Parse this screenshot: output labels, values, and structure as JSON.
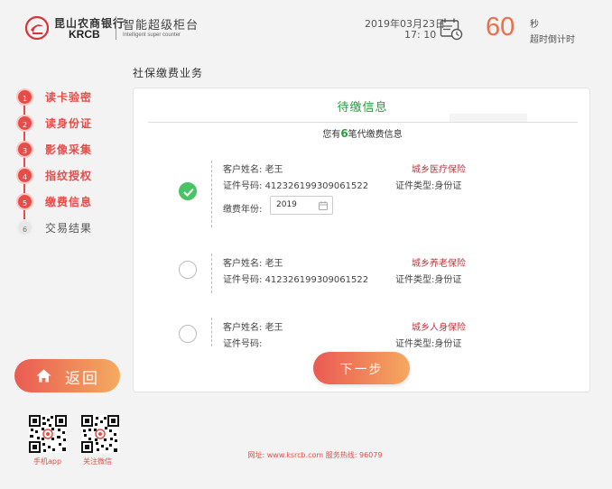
{
  "header": {
    "bank_name_cn": "昆山农商银行",
    "bank_name_en": "KRCB",
    "system_name": "智能超级柜台",
    "system_name_en": "Intelligent super counter",
    "date": "2019年03月23日",
    "time": "17: 10",
    "countdown_value": "60",
    "countdown_unit": "秒",
    "countdown_label": "超时倒计时"
  },
  "page_title": "社保缴费业务",
  "steps": [
    {
      "num": "1",
      "label": "读卡验密",
      "status": "done"
    },
    {
      "num": "2",
      "label": "读身份证",
      "status": "done"
    },
    {
      "num": "3",
      "label": "影像采集",
      "status": "done"
    },
    {
      "num": "4",
      "label": "指纹授权",
      "status": "done"
    },
    {
      "num": "5",
      "label": "缴费信息",
      "status": "active"
    },
    {
      "num": "6",
      "label": "交易结果",
      "status": "pending"
    }
  ],
  "back_button": {
    "label": "返回"
  },
  "panel": {
    "title": "待缴信息",
    "summary_prefix": "您有",
    "summary_count": "6",
    "summary_suffix": "笔代缴费信息",
    "items": [
      {
        "name_label": "客户姓名:",
        "name": "老王",
        "id_label": "证件号码:",
        "id_number": "412326199309061522",
        "insurance": "城乡医疗保险",
        "id_type_label": "证件类型:",
        "id_type": "身份证",
        "year_label": "缴费年份:",
        "year": "2019",
        "checked": true
      },
      {
        "name_label": "客户姓名:",
        "name": "老王",
        "id_label": "证件号码:",
        "id_number": "412326199309061522",
        "insurance": "城乡养老保险",
        "id_type_label": "证件类型:",
        "id_type": "身份证",
        "checked": false
      },
      {
        "name_label": "客户姓名:",
        "name": "老王",
        "id_label": "证件号码:",
        "id_number": "",
        "insurance": "城乡人身保险",
        "id_type_label": "证件类型:",
        "id_type": "身份证",
        "checked": false
      }
    ]
  },
  "next_button": {
    "label": "下一步"
  },
  "qr_codes": [
    {
      "label": "手机app"
    },
    {
      "label": "关注微信"
    }
  ],
  "footer": {
    "text": "网址: www.ksrcb.com 服务热线: 96079"
  },
  "colors": {
    "accent": "#e94b48",
    "success": "#2d9a44",
    "check": "#48c465",
    "countdown": "#e9704a"
  }
}
